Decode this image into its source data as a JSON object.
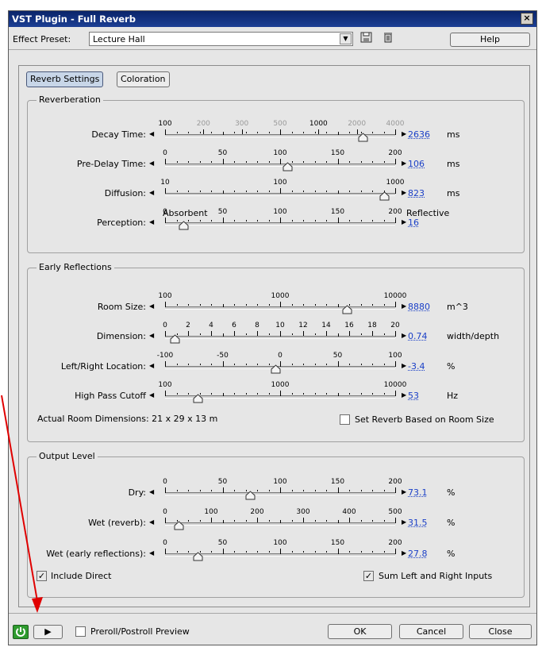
{
  "window": {
    "title": "VST Plugin - Full Reverb",
    "close_glyph": "×"
  },
  "preset": {
    "label": "Effect Preset:",
    "value": "Lecture Hall",
    "help_label": "Help"
  },
  "tabs": [
    {
      "label": "Reverb Settings",
      "active": true
    },
    {
      "label": "Coloration",
      "active": false
    }
  ],
  "reverberation": {
    "title": "Reverberation",
    "sliders": [
      {
        "label": "Decay Time:",
        "ticks": [
          "100",
          "200",
          "300",
          "500",
          "1000",
          "2000",
          "4000"
        ],
        "value": "2636",
        "unit": "ms",
        "level": 0.86
      },
      {
        "label": "Pre-Delay Time:",
        "ticks": [
          "0",
          "50",
          "100",
          "150",
          "200"
        ],
        "value": "106",
        "unit": "ms",
        "level": 0.53
      },
      {
        "label": "Diffusion:",
        "ticks": [
          "10",
          "100",
          "1000"
        ],
        "value": "823",
        "unit": "ms",
        "level": 0.95
      },
      {
        "label": "Perception:",
        "ticks": [
          "0",
          "50",
          "100",
          "150",
          "200"
        ],
        "value": "16",
        "unit": "",
        "level": 0.08,
        "left_caption": "Absorbent",
        "right_caption": "Reflective"
      }
    ]
  },
  "early_reflections": {
    "title": "Early Reflections",
    "sliders": [
      {
        "label": "Room Size:",
        "ticks": [
          "100",
          "1000",
          "10000"
        ],
        "value": "8880",
        "unit": "m^3",
        "level": 0.79
      },
      {
        "label": "Dimension:",
        "ticks": [
          "0",
          "2",
          "4",
          "6",
          "8",
          "10",
          "12",
          "14",
          "16",
          "18",
          "20"
        ],
        "value": "0.74",
        "unit": "width/depth",
        "level": 0.04
      },
      {
        "label": "Left/Right Location:",
        "ticks": [
          "-100",
          "-50",
          "0",
          "50",
          "100"
        ],
        "value": "-3.4",
        "unit": "%",
        "level": 0.48
      },
      {
        "label": "High Pass Cutoff",
        "ticks": [
          "100",
          "1000",
          "10000"
        ],
        "value": "53",
        "unit": "Hz",
        "level": 0.14
      }
    ],
    "room_dimensions": "Actual Room Dimensions: 21 x 29 x 13 m",
    "set_reverb_label": "Set Reverb Based on Room Size",
    "set_reverb_checked": false
  },
  "output_level": {
    "title": "Output Level",
    "sliders": [
      {
        "label": "Dry:",
        "ticks": [
          "0",
          "50",
          "100",
          "150",
          "200"
        ],
        "value": "73.1",
        "unit": "%",
        "level": 0.37
      },
      {
        "label": "Wet (reverb):",
        "ticks": [
          "0",
          "100",
          "200",
          "300",
          "400",
          "500"
        ],
        "value": "31.5",
        "unit": "%",
        "level": 0.06
      },
      {
        "label": "Wet (early reflections):",
        "ticks": [
          "0",
          "50",
          "100",
          "150",
          "200"
        ],
        "value": "27.8",
        "unit": "%",
        "level": 0.14
      }
    ],
    "include_direct_label": "Include Direct",
    "include_direct_checked": true,
    "sum_inputs_label": "Sum Left and Right Inputs",
    "sum_inputs_checked": true
  },
  "footer": {
    "preview_label": "Preroll/Postroll Preview",
    "ok_label": "OK",
    "cancel_label": "Cancel",
    "close_label": "Close"
  },
  "colors": {
    "value_link": "#1a3fc7",
    "power_green": "#2e9b2e",
    "annotation_arrow": "#e00000"
  }
}
